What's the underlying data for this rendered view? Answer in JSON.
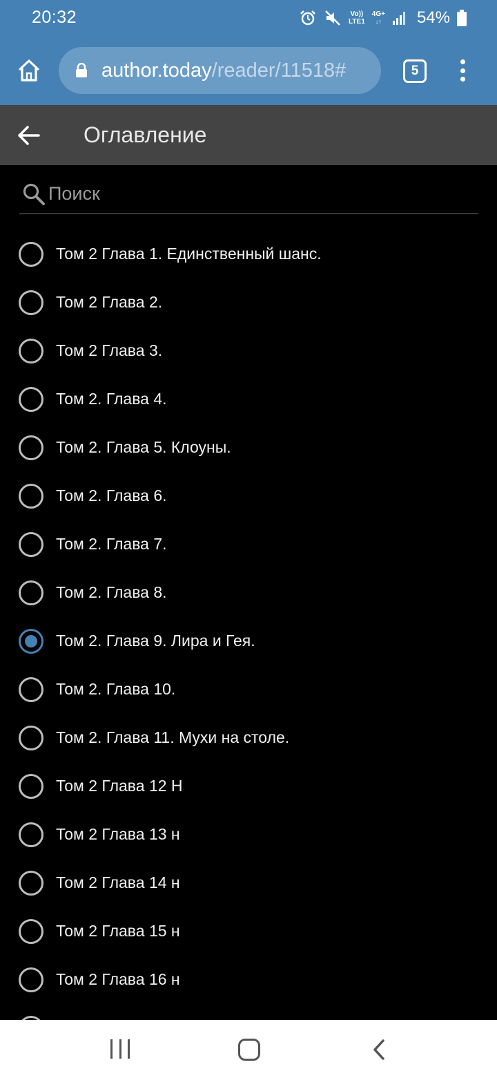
{
  "status_bar": {
    "time": "20:32",
    "volte_label": "Vo))",
    "lte_label": "LTE1",
    "network_label": "4G+",
    "battery": "54%",
    "icons": [
      "alarm-icon",
      "mute-icon",
      "signal-icon",
      "battery-icon"
    ]
  },
  "browser": {
    "url_domain": "author.today",
    "url_path": "/reader/11518#",
    "tab_count": "5"
  },
  "header": {
    "title": "Оглавление"
  },
  "search": {
    "placeholder": "Поиск",
    "value": ""
  },
  "chapters": [
    {
      "label": "Том 2 Глава 1. Единственный шанс.",
      "selected": false
    },
    {
      "label": "Том 2 Глава 2.",
      "selected": false
    },
    {
      "label": "Том 2 Глава 3.",
      "selected": false
    },
    {
      "label": "Том 2. Глава 4.",
      "selected": false
    },
    {
      "label": "Том 2. Глава 5. Клоуны.",
      "selected": false
    },
    {
      "label": "Том 2. Глава 6.",
      "selected": false
    },
    {
      "label": "Том 2. Глава 7.",
      "selected": false
    },
    {
      "label": "Том 2. Глава 8.",
      "selected": false
    },
    {
      "label": "Том 2. Глава 9. Лира и Гея.",
      "selected": true
    },
    {
      "label": "Том 2. Глава 10.",
      "selected": false
    },
    {
      "label": "Том 2. Глава 11. Мухи на столе.",
      "selected": false
    },
    {
      "label": "Том 2 Глава 12 Н",
      "selected": false
    },
    {
      "label": "Том 2 Глава 13 н",
      "selected": false
    },
    {
      "label": "Том 2 Глава 14 н",
      "selected": false
    },
    {
      "label": "Том 2 Глава 15 н",
      "selected": false
    },
    {
      "label": "Том 2 Глава 16 н",
      "selected": false
    },
    {
      "label": "",
      "selected": false
    }
  ],
  "colors": {
    "accent": "#4581b4",
    "header_bg": "#444444",
    "list_bg": "#000000",
    "text": "#f0f0f0"
  }
}
